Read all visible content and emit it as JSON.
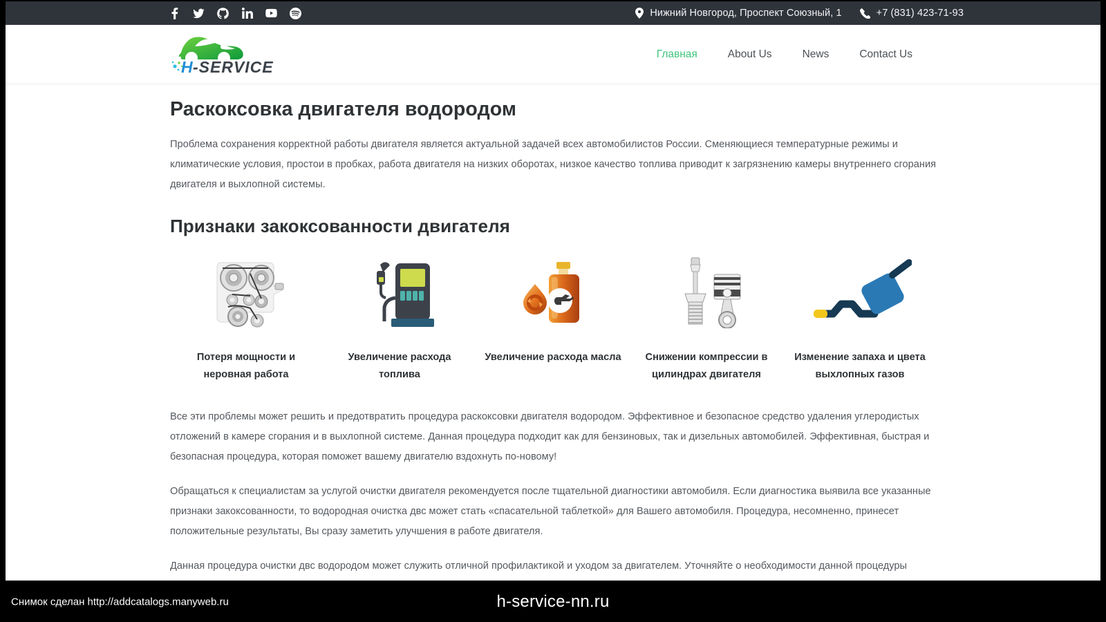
{
  "topbar": {
    "social": [
      {
        "name": "facebook-icon",
        "label": "Facebook"
      },
      {
        "name": "twitter-icon",
        "label": "Twitter"
      },
      {
        "name": "github-icon",
        "label": "GitHub"
      },
      {
        "name": "linkedin-icon",
        "label": "LinkedIn"
      },
      {
        "name": "youtube-icon",
        "label": "YouTube"
      },
      {
        "name": "spotify-icon",
        "label": "Spotify"
      }
    ],
    "address": "Нижний Новгород, Проспект Союзный, 1",
    "phone": "+7 (831) 423-71-93",
    "background": "#2f333a"
  },
  "logo": {
    "text_primary": "H",
    "text_secondary": "-SERVICE",
    "car_color": "#2eb34a",
    "h_color": "#1f8fd8",
    "service_color": "#3b4249"
  },
  "nav": {
    "items": [
      {
        "label": "Главная",
        "active": true
      },
      {
        "label": "About Us",
        "active": false
      },
      {
        "label": "News",
        "active": false
      },
      {
        "label": "Contact Us",
        "active": false
      }
    ],
    "active_color": "#3fc47c"
  },
  "main": {
    "title": "Раскоксовка двигателя водородом",
    "intro": "Проблема сохранения корректной работы двигателя является актуальной задачей всех автомобилистов России. Сменяющиеся температурные режимы и климатические условия, простои в пробках, работа двигателя на низких оборотах, низкое качество топлива приводит к загрязнению камеры внутреннего сгорания двигателя и выхлопной системы.",
    "section_title": "Признаки закоксованности двигателя",
    "features": [
      {
        "icon": "timing-belt-icon",
        "label": "Потеря мощности и неровная работа"
      },
      {
        "icon": "fuel-pump-icon",
        "label": "Увеличение расхода топлива"
      },
      {
        "icon": "oil-bottle-icon",
        "label": "Увеличение расхода масла"
      },
      {
        "icon": "spark-plug-piston-icon",
        "label": "Снижении компрессии в цилиндрах двигателя"
      },
      {
        "icon": "exhaust-muffler-icon",
        "label": "Изменение запаха и цвета выхлопных газов"
      }
    ],
    "paragraphs": [
      "Все эти проблемы может решить и предотвратить процедура раскоксовки двигателя водородом. Эффективное и безопасное средство удаления углеродистых отложений в камере сгорания и в выхлопной системе. Данная процедура подходит как для бензиновых, так и дизельных автомобилей. Эффективная, быстрая и безопасная процедура, которая поможет вашему двигателю вздохнуть по-новому!",
      "Обращаться к специалистам за услугой очистки двигателя рекомендуется после тщательной диагностики автомобиля. Если диагностика выявила все указанные признаки закоксованности, то водородная очистка двс может стать «спасательной таблеткой» для Вашего автомобиля. Процедура, несомненно, принесет положительные результаты, Вы сразу заметить улучшения в работе двигателя.",
      "Данная процедура очистки двс водородом может служить отличной профилактикой и уходом за двигателем. Уточняйте о необходимости данной процедуры конкретно Вашего автомобиля у специалистов H-SERVICE."
    ]
  },
  "watermark": {
    "left_text": "Снимок сделан http://addcatalogs.manyweb.ru",
    "center_text": "h-service-nn.ru"
  }
}
